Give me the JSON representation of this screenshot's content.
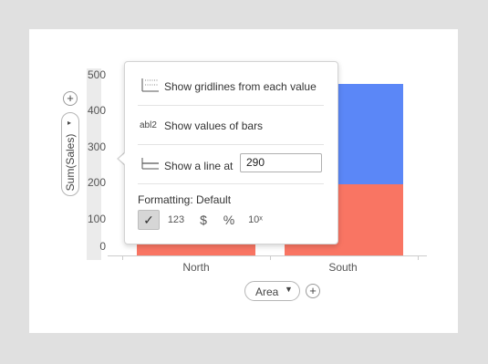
{
  "chart_data": {
    "type": "bar",
    "stacked": true,
    "categories": [
      "North",
      "South"
    ],
    "series": [
      {
        "values": [
          210,
          200
        ],
        "color": "#f97563"
      },
      {
        "values": [
          0,
          280
        ],
        "color": "#5b87f7"
      }
    ],
    "ylabel": "Sum(Sales)",
    "xlabel": "Area",
    "yticks": [
      "500",
      "400",
      "300",
      "200",
      "100",
      "0"
    ],
    "ylim": [
      0,
      500
    ]
  },
  "axis": {
    "y_label": "Sum(Sales)",
    "x_label": "Area",
    "x_dropdown_icon": "caret-down-icon",
    "add_icon": "plus-icon"
  },
  "popup": {
    "gridlines_label": "Show gridlines from each value",
    "values_icon_text": "abl2",
    "values_label": "Show values of bars",
    "line_label": "Show a line at",
    "line_value": "290",
    "formatting_label": "Formatting:",
    "formatting_value": "Default",
    "format_buttons": {
      "check": "✓",
      "number": "123",
      "currency": "$",
      "percent": "%",
      "scientific": "10ˣ"
    }
  }
}
